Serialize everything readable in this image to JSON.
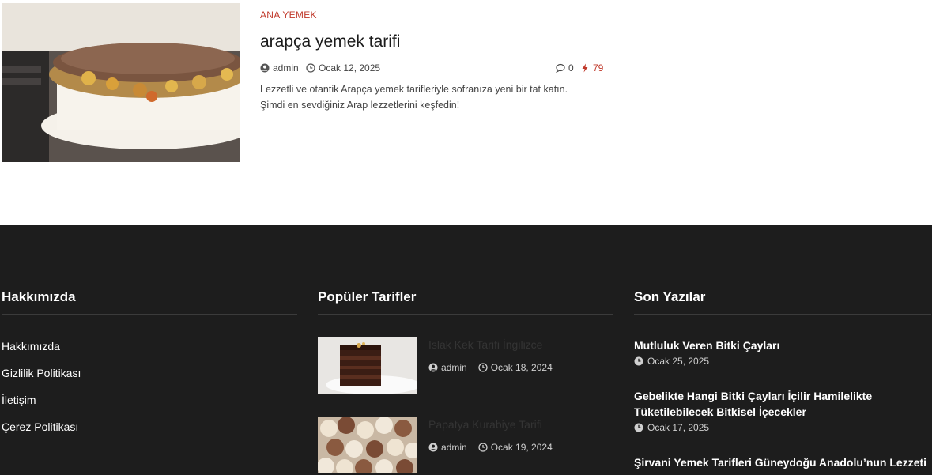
{
  "post": {
    "category": "ANA YEMEK",
    "title": "arapça yemek tarifi",
    "author": "admin",
    "date": "Ocak 12, 2025",
    "comments": "0",
    "views": "79",
    "excerpt": "Lezzetli ve otantik Arapça yemek tarifleriyle sofranıza yeni bir tat katın. Şimdi en sevdiğiniz Arap lezzetlerini keşfedin!"
  },
  "footer": {
    "about": {
      "heading": "Hakkımızda",
      "links": [
        "Hakkımızda",
        "Gizlilik Politikası",
        "İletişim",
        "Çerez Politikası"
      ]
    },
    "popular": {
      "heading": "Popüler Tarifler",
      "items": [
        {
          "title": "Islak Kek Tarifi İngilizce",
          "author": "admin",
          "date": "Ocak 18, 2024"
        },
        {
          "title": "Papatya Kurabiye Tarifi",
          "author": "admin",
          "date": "Ocak 19, 2024"
        }
      ]
    },
    "recent": {
      "heading": "Son Yazılar",
      "items": [
        {
          "title": "Mutluluk Veren Bitki Çayları",
          "date": "Ocak 25, 2025"
        },
        {
          "title": "Gebelikte Hangi Bitki Çayları İçilir Hamilelikte Tüketilebilecek Bitkisel İçecekler",
          "date": "Ocak 17, 2025"
        },
        {
          "title": "Şirvani Yemek Tarifleri Güneydoğu Anadolu’nun Lezzeti",
          "date": ""
        }
      ]
    }
  },
  "colors": {
    "accent": "#c0392b",
    "footer_bg": "#1d1d1d"
  },
  "icons": {
    "author": "user-circle-icon",
    "date": "clock-icon",
    "comments": "comment-icon",
    "views": "bolt-icon"
  }
}
